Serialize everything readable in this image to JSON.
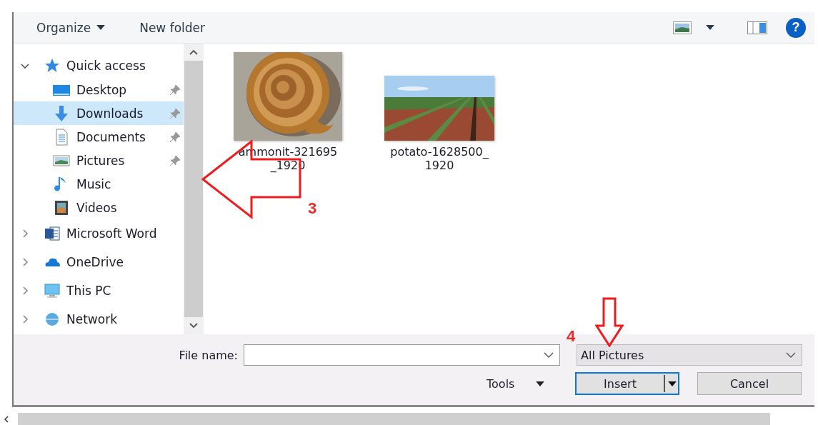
{
  "toolbar": {
    "organize": "Organize",
    "new_folder": "New folder",
    "help": "?"
  },
  "nav": [
    {
      "label": "Quick access",
      "kind": "quick",
      "expanded": true,
      "children": [
        {
          "label": "Desktop",
          "kind": "desktop",
          "selected": false,
          "pinned": true
        },
        {
          "label": "Downloads",
          "kind": "downloads",
          "selected": true,
          "pinned": true
        },
        {
          "label": "Documents",
          "kind": "documents",
          "selected": false,
          "pinned": true
        },
        {
          "label": "Pictures",
          "kind": "pictures",
          "selected": false,
          "pinned": true
        },
        {
          "label": "Music",
          "kind": "music",
          "selected": false,
          "pinned": false
        },
        {
          "label": "Videos",
          "kind": "videos",
          "selected": false,
          "pinned": false
        }
      ]
    },
    {
      "label": "Microsoft Word",
      "kind": "word",
      "expanded": false
    },
    {
      "label": "OneDrive",
      "kind": "cloud",
      "expanded": false
    },
    {
      "label": "This PC",
      "kind": "pc",
      "expanded": false
    },
    {
      "label": "Network",
      "kind": "network",
      "expanded": false
    }
  ],
  "files": [
    {
      "name_lines": [
        "ammonit-321695",
        "_1920"
      ],
      "kind": "shell"
    },
    {
      "name_lines": [
        "potato-1628500_",
        "1920"
      ],
      "kind": "field"
    }
  ],
  "file_name": {
    "label": "File name:"
  },
  "file_type": {
    "value": "All Pictures"
  },
  "tools": "Tools",
  "insert": "Insert",
  "cancel": "Cancel",
  "annotations": [
    {
      "label": "3",
      "kind": "left"
    },
    {
      "label": "4",
      "kind": "down"
    }
  ]
}
